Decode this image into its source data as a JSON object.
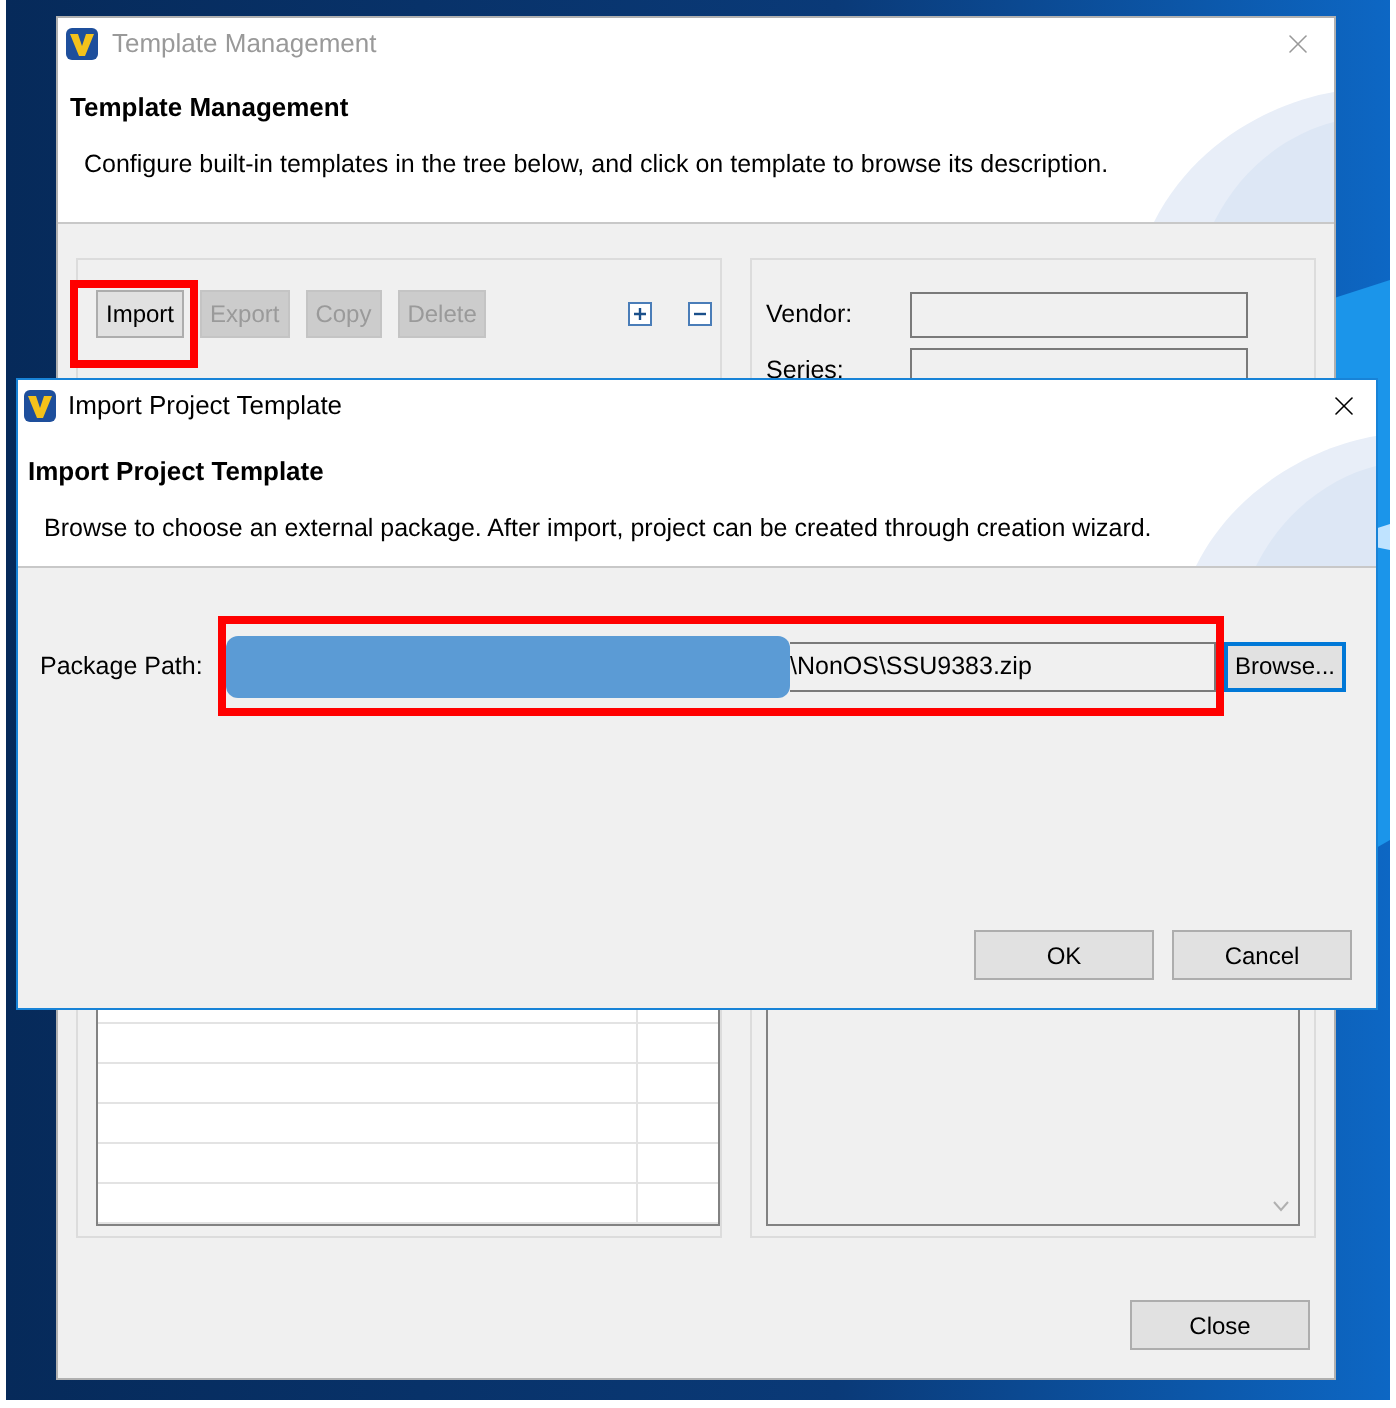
{
  "background_window": {
    "title": "Template Management",
    "heading": "Template Management",
    "description": "Configure built-in templates in the tree below, and click on template to browse its description.",
    "toolbar": [
      {
        "label": "Import",
        "disabled": false,
        "highlighted": true
      },
      {
        "label": "Export",
        "disabled": true,
        "highlighted": false
      },
      {
        "label": "Copy",
        "disabled": true,
        "highlighted": false
      },
      {
        "label": "Delete",
        "disabled": true,
        "highlighted": false
      }
    ],
    "fields": [
      {
        "label": "Vendor:"
      },
      {
        "label": "Series:"
      }
    ],
    "close_button": "Close"
  },
  "dialog": {
    "title": "Import Project Template",
    "heading": "Import Project Template",
    "description": "Browse to choose an external package. After import, project can be created through creation wizard.",
    "package_path": {
      "label": "Package Path:",
      "value": "\\NonOS\\SSU9383.zip",
      "highlighted": true,
      "redacted": true
    },
    "browse_button": "Browse...",
    "buttons": [
      "OK",
      "Cancel"
    ]
  }
}
